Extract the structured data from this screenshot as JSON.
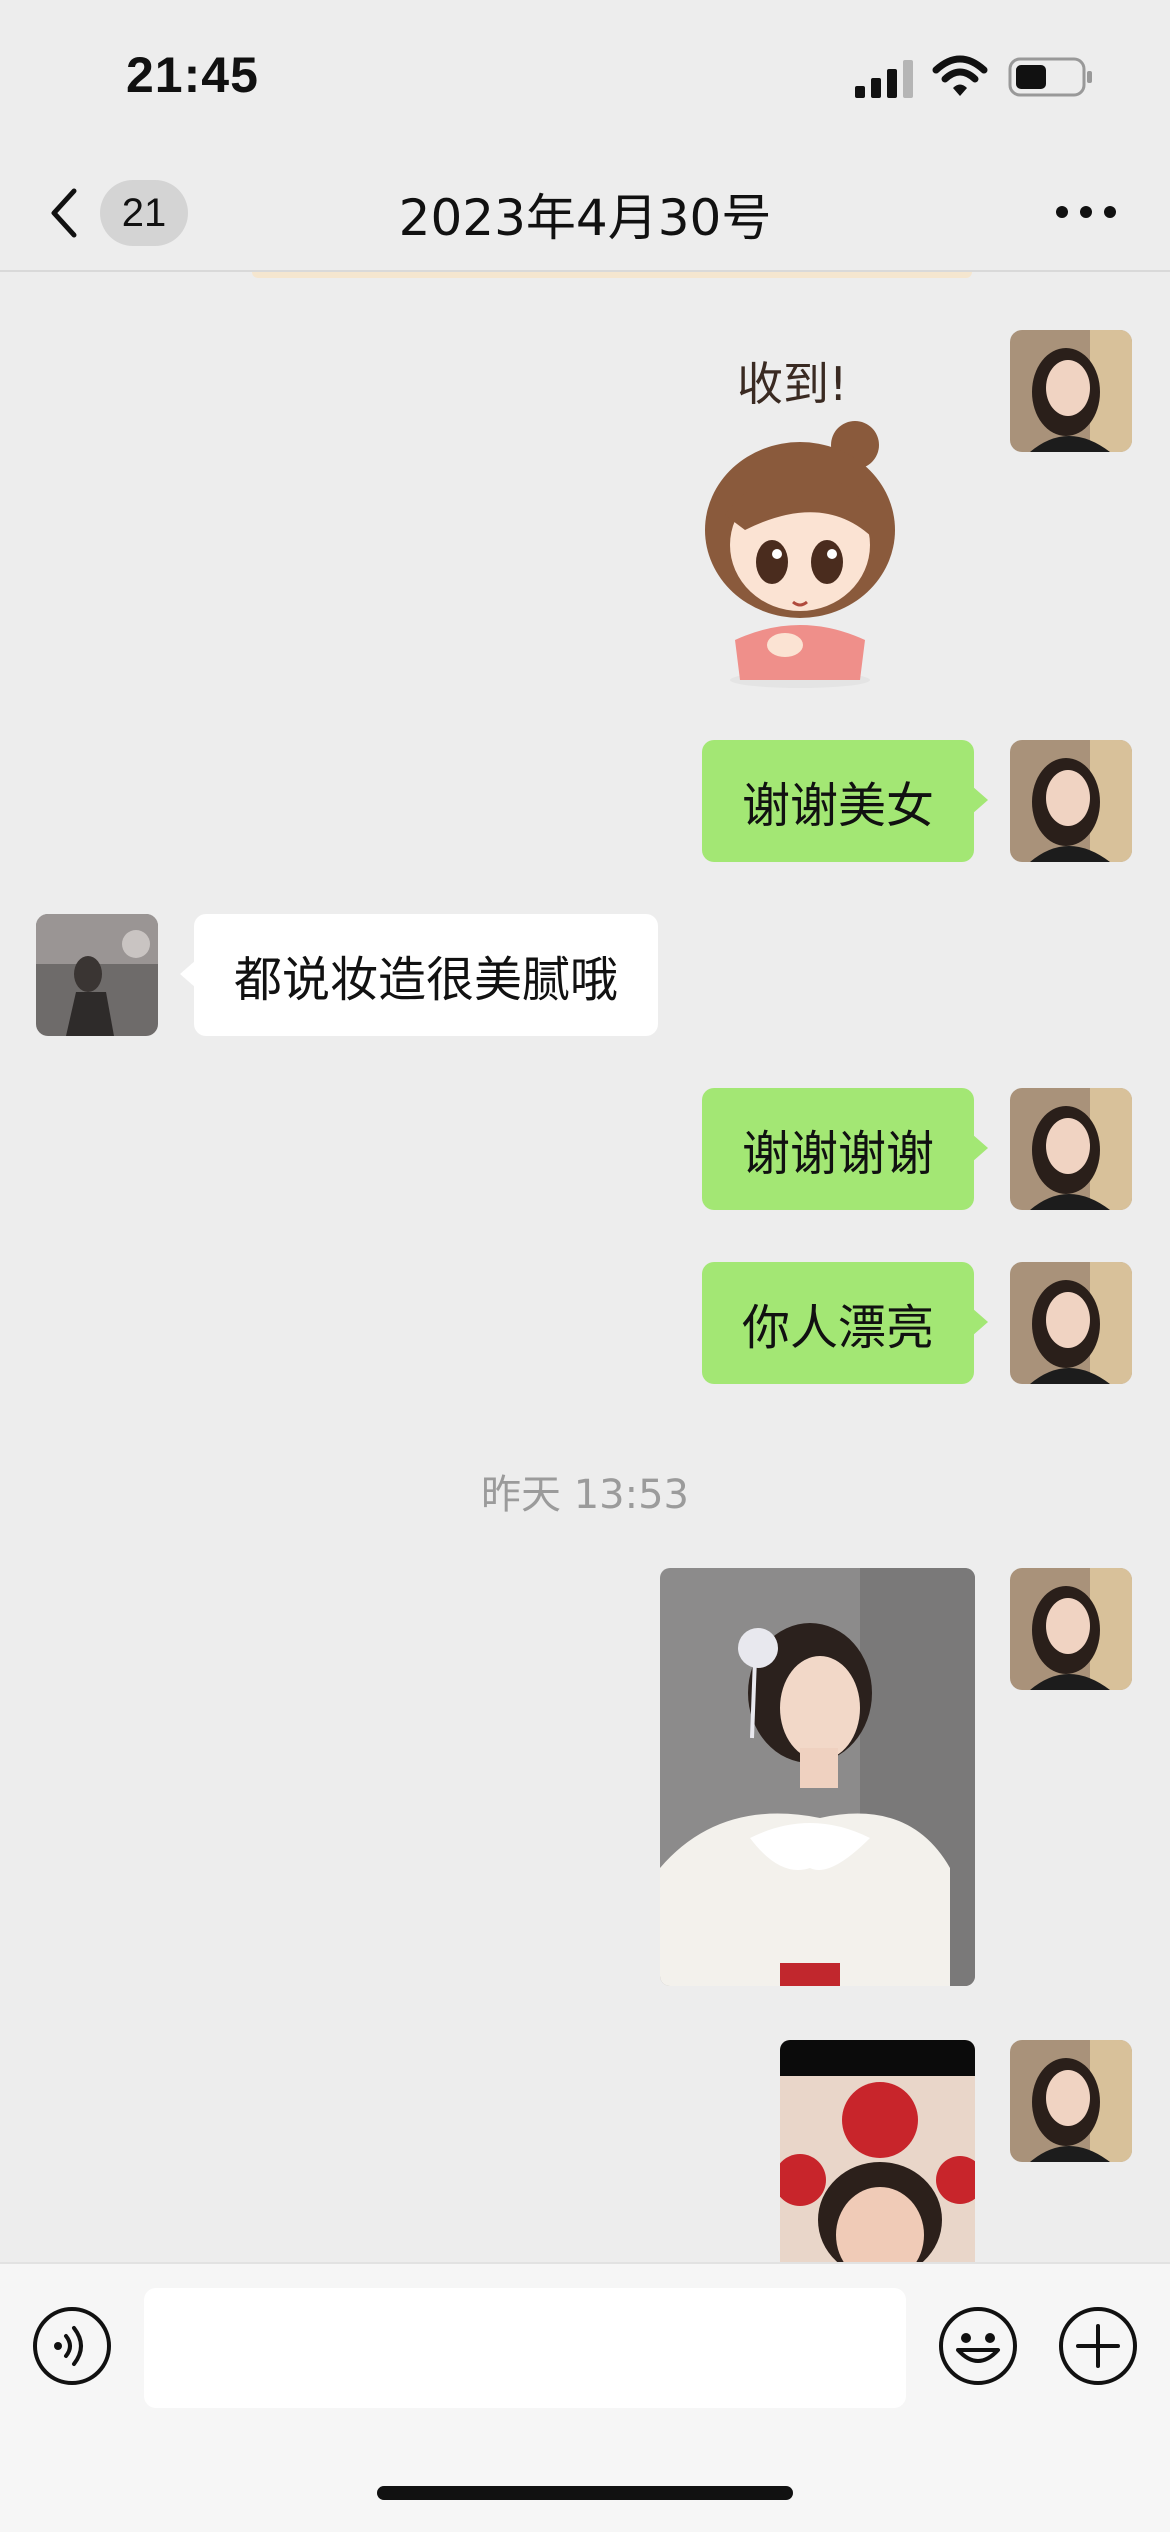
{
  "status_bar": {
    "time": "21:45"
  },
  "nav": {
    "back_badge": "21",
    "title": "2023年4月30号"
  },
  "sticker": {
    "caption": "收到!"
  },
  "messages": [
    {
      "side": "out",
      "type": "text",
      "text": "谢谢美女"
    },
    {
      "side": "in",
      "type": "text",
      "text": "都说妆造很美腻哦"
    },
    {
      "side": "out",
      "type": "text",
      "text": "谢谢谢谢"
    },
    {
      "side": "out",
      "type": "text",
      "text": "你人漂亮"
    }
  ],
  "timestamp": "昨天 13:53",
  "input": {
    "value": "",
    "placeholder": ""
  },
  "colors": {
    "outgoing_bubble": "#a3e774",
    "incoming_bubble": "#ffffff",
    "background": "#ededed"
  },
  "icons": [
    "back-chevron-icon",
    "more-icon",
    "voice-icon",
    "emoji-icon",
    "plus-icon"
  ]
}
